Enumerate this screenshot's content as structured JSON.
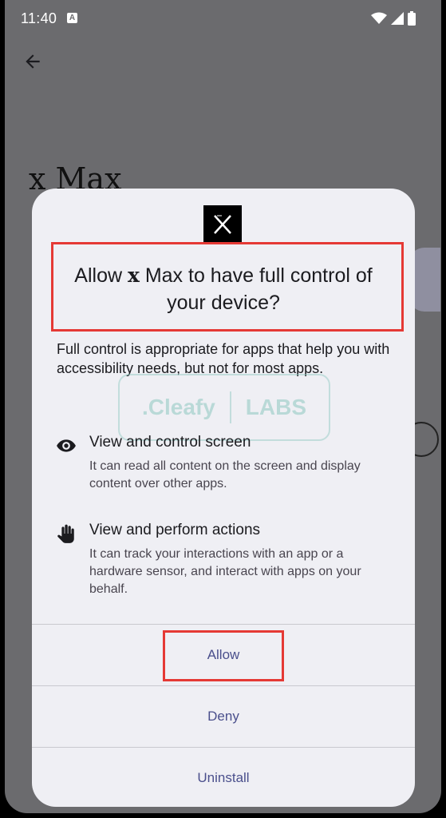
{
  "status_bar": {
    "time": "11:40",
    "notification_icon": "a-notification-icon",
    "icons": [
      "wifi-icon",
      "signal-icon",
      "battery-icon"
    ]
  },
  "background_app": {
    "title": "x Max",
    "back_icon": "arrow-back-icon"
  },
  "dialog": {
    "title_prefix": "Allow ",
    "title_app_x": "x",
    "title_app_name": " Max",
    "title_suffix": " to have full control of your device?",
    "description": "Full control is appropriate for apps that help you with accessibility needs, but not for most apps.",
    "watermark_left": ".Cleafy",
    "watermark_right": "LABS",
    "permissions": [
      {
        "icon": "eye-icon",
        "title": "View and control screen",
        "description": "It can read all content on the screen and display content over other apps."
      },
      {
        "icon": "hand-icon",
        "title": "View and perform actions",
        "description": "It can track your interactions with an app or a hardware sensor, and interact with apps on your behalf."
      }
    ],
    "actions": {
      "allow": "Allow",
      "deny": "Deny",
      "uninstall": "Uninstall"
    }
  },
  "colors": {
    "highlight": "#e53935",
    "action_text": "#4a4f8c",
    "dialog_bg": "#efeff4",
    "scrim": "#6b6b6e"
  }
}
